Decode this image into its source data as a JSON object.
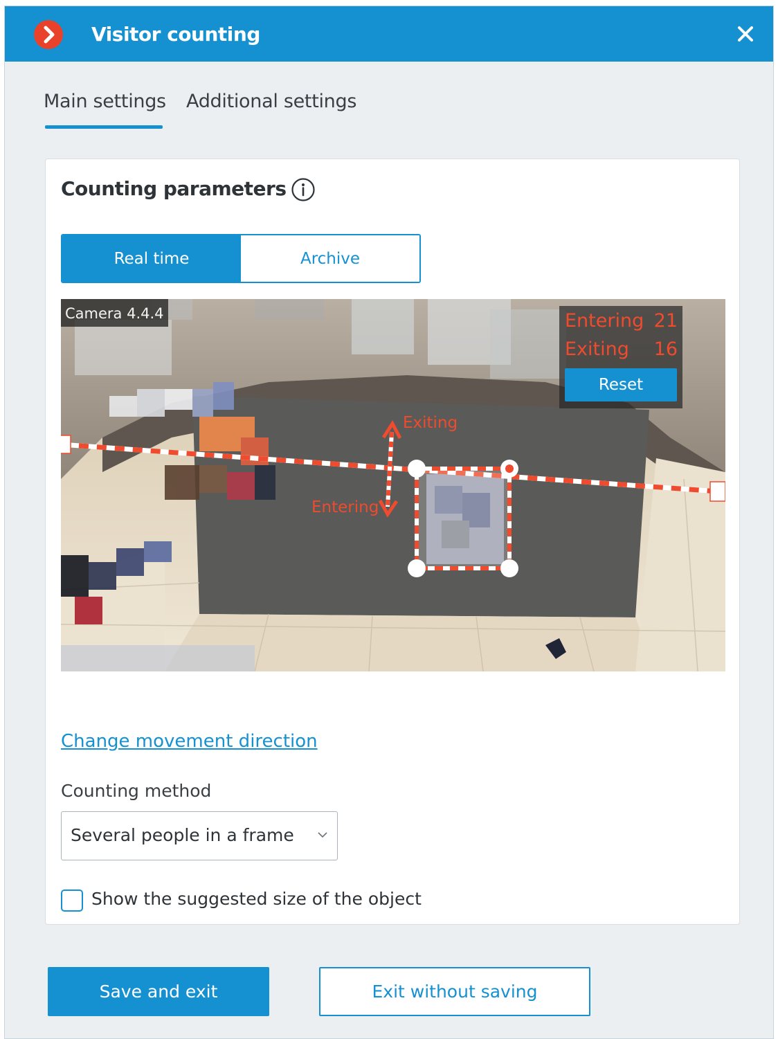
{
  "window": {
    "title": "Visitor counting",
    "close_icon": "close-icon",
    "logo_icon": "chevron-right-circle-icon"
  },
  "tabs": [
    {
      "label": "Main settings",
      "active": true
    },
    {
      "label": "Additional settings",
      "active": false
    }
  ],
  "panel": {
    "title": "Counting parameters",
    "info_icon": "info-icon"
  },
  "mode": {
    "options": [
      "Real time",
      "Archive"
    ],
    "selected": "Real time"
  },
  "video": {
    "camera_label": "Camera 4.4.4",
    "entering_label": "Entering",
    "entering_count": "21",
    "exiting_label": "Exiting",
    "exiting_count": "16",
    "reset_label": "Reset",
    "direction_exiting": "Exiting",
    "direction_entering": "Entering"
  },
  "change_direction_link": "Change movement direction",
  "counting_method": {
    "label": "Counting method",
    "value": "Several people in a frame"
  },
  "show_size": {
    "label": "Show the suggested size of the object",
    "checked": false
  },
  "footer": {
    "save_label": "Save and exit",
    "exit_label": "Exit without saving"
  },
  "colors": {
    "accent": "#1591d2",
    "overlay_red": "#ef4b2e",
    "logo_red": "#e8432a"
  }
}
